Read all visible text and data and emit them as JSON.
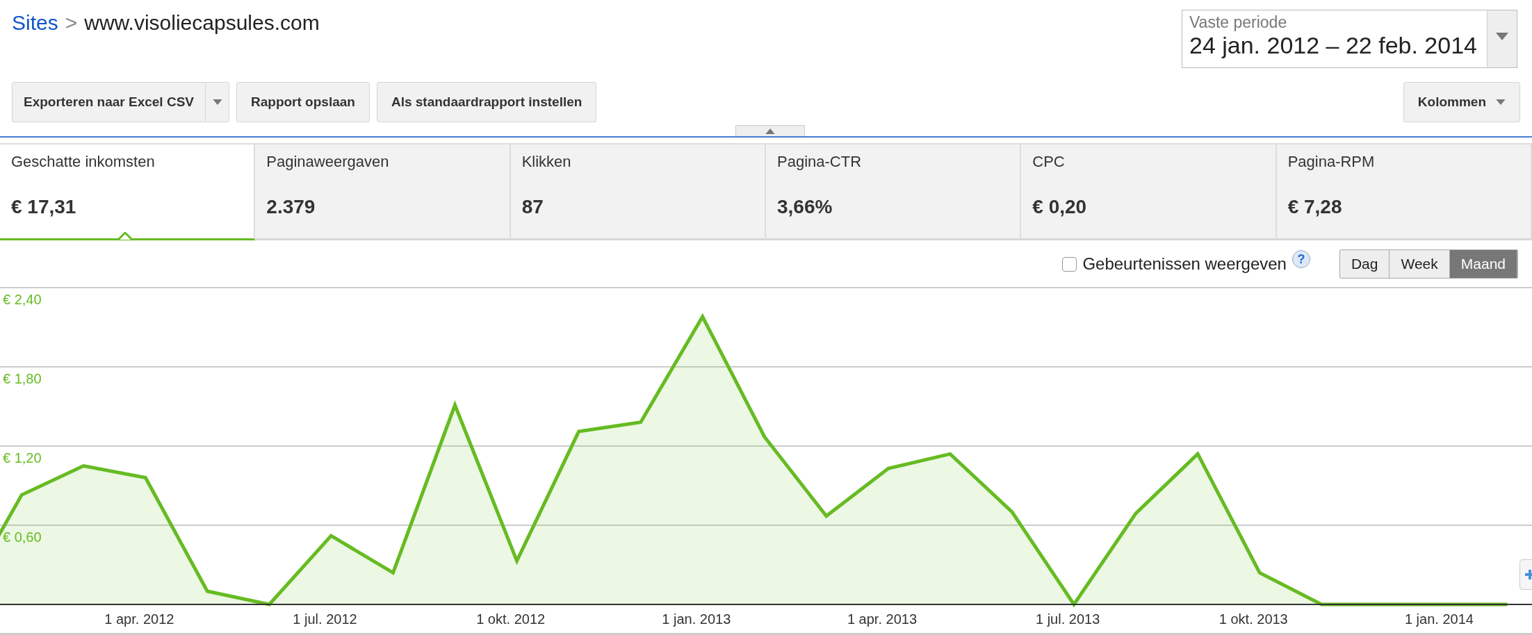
{
  "breadcrumb": {
    "link": "Sites",
    "separator": ">",
    "current": "www.visoliecapsules.com"
  },
  "date_range": {
    "label": "Vaste periode",
    "value": "24 jan. 2012 – 22 feb. 2014"
  },
  "toolbar": {
    "buttons": [
      {
        "label": "Exporteren naar Excel CSV",
        "kind": "split"
      },
      {
        "label": "Rapport opslaan",
        "kind": "plain"
      },
      {
        "label": "Als standaardrapport instellen",
        "kind": "plain"
      }
    ],
    "columns_button": "Kolommen"
  },
  "metrics": [
    {
      "label": "Geschatte inkomsten",
      "value": "€ 17,31",
      "selected": true
    },
    {
      "label": "Paginaweergaven",
      "value": "2.379",
      "selected": false
    },
    {
      "label": "Klikken",
      "value": "87",
      "selected": false
    },
    {
      "label": "Pagina-CTR",
      "value": "3,66%",
      "selected": false
    },
    {
      "label": "CPC",
      "value": "€ 0,20",
      "selected": false
    },
    {
      "label": "Pagina-RPM",
      "value": "€ 7,28",
      "selected": false
    }
  ],
  "events": {
    "label": "Gebeurtenissen weergeven",
    "checked": false,
    "help": "?"
  },
  "granularity": [
    {
      "label": "Dag",
      "selected": false
    },
    {
      "label": "Week",
      "selected": false
    },
    {
      "label": "Maand",
      "selected": true
    }
  ],
  "chart": {
    "chart_data": {
      "type": "area",
      "categories": [
        null,
        null,
        null,
        "1 apr. 2012",
        null,
        null,
        "1 jul. 2012",
        null,
        null,
        "1 okt. 2012",
        null,
        null,
        "1 jan. 2013",
        null,
        null,
        "1 apr. 2013",
        null,
        null,
        "1 jul. 2013",
        null,
        null,
        "1 okt. 2013",
        null,
        null,
        "1 jan. 2014",
        null
      ],
      "series": [
        {
          "color": "#66bb22",
          "values": [
            0,
            0.83,
            1.05,
            0.96,
            0.1,
            0,
            0.52,
            0.24,
            1.51,
            0.33,
            1.31,
            1.38,
            2.18,
            1.27,
            0.67,
            1.03,
            1.14,
            0.7,
            0,
            0.69,
            1.14,
            0.24,
            0,
            0,
            0,
            0
          ]
        }
      ],
      "grid": true,
      "ylim": [
        0,
        2.4
      ],
      "yticks": [
        {
          "value": 0.6,
          "label": "€ 0,60"
        },
        {
          "value": 1.2,
          "label": "€ 1,20"
        },
        {
          "value": 1.8,
          "label": "€ 1,80"
        },
        {
          "value": 2.4,
          "label": "€ 2,40"
        }
      ]
    }
  }
}
